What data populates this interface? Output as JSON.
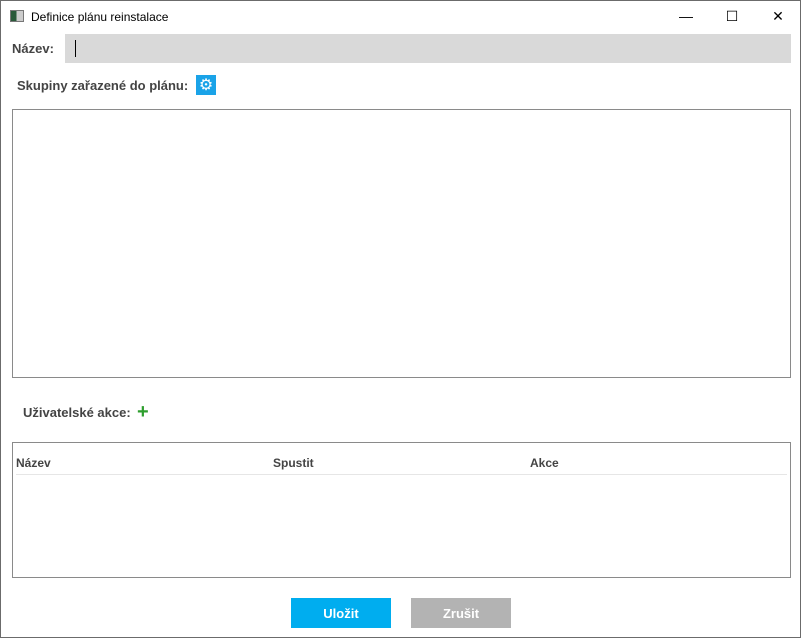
{
  "window": {
    "title": "Definice plánu reinstalace",
    "minimize": "—",
    "maximize": "☐",
    "close": "✕"
  },
  "name": {
    "label": "Název:",
    "value": ""
  },
  "groups": {
    "label": "Skupiny zařazené do plánu:",
    "icon": "gear-icon"
  },
  "actions": {
    "label": "Uživatelské akce:",
    "add_icon": "plus-icon",
    "add_color": "#2e9e2e",
    "columns": [
      "Název",
      "Spustit",
      "Akce"
    ]
  },
  "buttons": {
    "save": "Uložit",
    "cancel": "Zrušit",
    "save_color": "#00adef",
    "cancel_color": "#b3b3b3"
  }
}
